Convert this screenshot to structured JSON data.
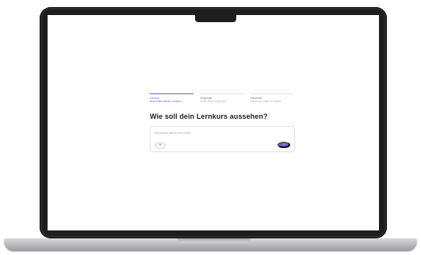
{
  "stepper": {
    "steps": [
      {
        "title": "Lernkurs",
        "subtitle": "Beschreibe deinen Lernkurs"
      },
      {
        "title": "Zielgruppe",
        "subtitle": "Wähle deine Zielgruppe"
      },
      {
        "title": "Parameter",
        "subtitle": "Erfahrung, Dauer & Vorteile"
      }
    ]
  },
  "main": {
    "headline": "Wie soll dein Lernkurs aussehen?",
    "prompt_placeholder": "Beschreibe deinen Kurs-Inhalt",
    "add_symbol": "+",
    "send_symbol": "↑"
  },
  "colors": {
    "accent": "#7b5cd6",
    "text_primary": "#222225",
    "laptop_frame": "#1e1e20"
  },
  "icons": {
    "add": "plus-icon",
    "send": "arrow-up-icon"
  }
}
